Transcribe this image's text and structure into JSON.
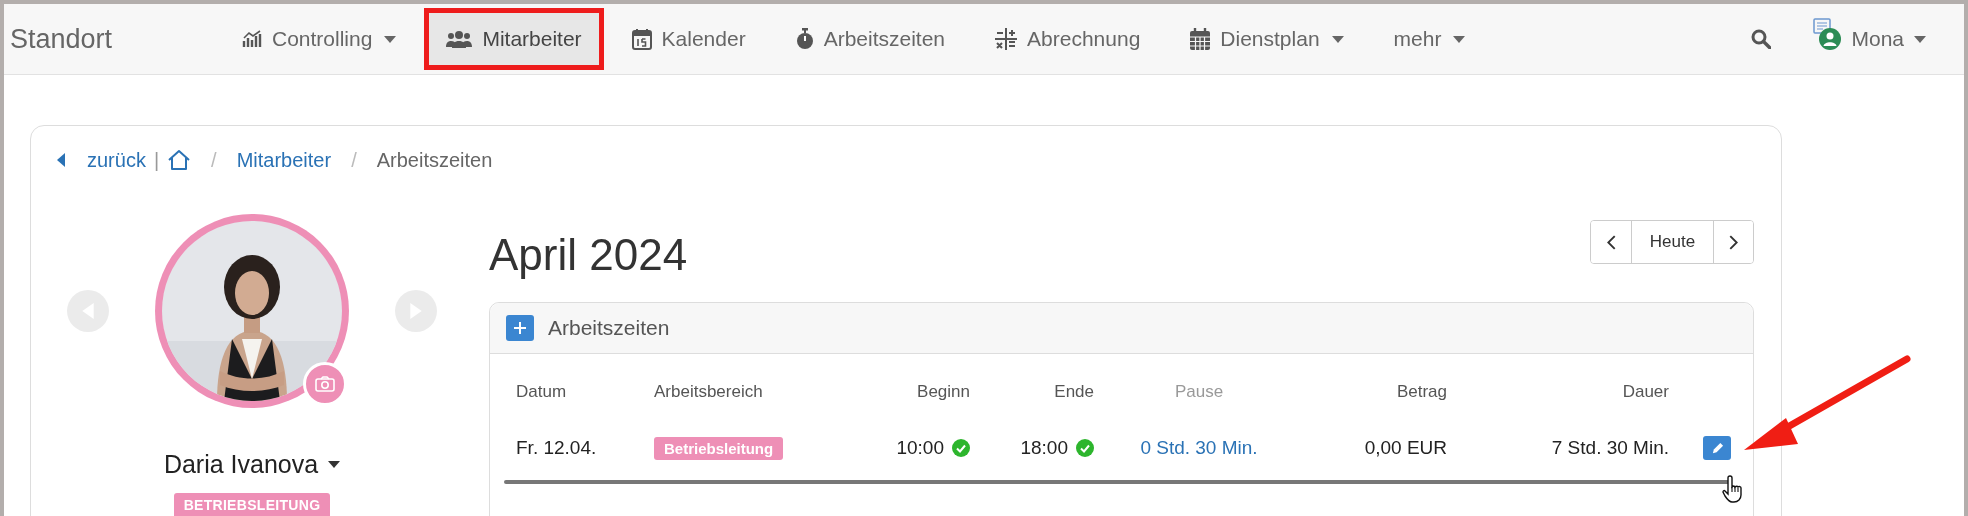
{
  "navbar": {
    "brand": "Standort",
    "items": [
      {
        "label": "Controlling",
        "caret": true,
        "selected": false,
        "outlined": false
      },
      {
        "label": "Mitarbeiter",
        "caret": false,
        "selected": true,
        "outlined": true
      },
      {
        "label": "Kalender",
        "caret": false,
        "selected": false,
        "outlined": false
      },
      {
        "label": "Arbeitszeiten",
        "caret": false,
        "selected": false,
        "outlined": false
      },
      {
        "label": "Abrechnung",
        "caret": false,
        "selected": false,
        "outlined": false
      },
      {
        "label": "Dienstplan",
        "caret": true,
        "selected": false,
        "outlined": false
      },
      {
        "label": "mehr",
        "caret": true,
        "selected": false,
        "outlined": false
      }
    ],
    "user": "Mona"
  },
  "breadcrumb": {
    "back": "zurück",
    "separator": "|",
    "items": [
      {
        "divider": "/",
        "label": "Mitarbeiter",
        "link": true
      },
      {
        "divider": "/",
        "label": "Arbeitszeiten",
        "link": false
      }
    ]
  },
  "profile": {
    "name": "Daria Ivanova",
    "role": "BETRIEBSLEITUNG"
  },
  "month": {
    "title": "April 2024",
    "today": "Heute"
  },
  "panel": {
    "title": "Arbeitszeiten",
    "columns": [
      {
        "label": "Datum",
        "dimmed": false
      },
      {
        "label": "Arbeitsbereich",
        "dimmed": false
      },
      {
        "label": "Beginn",
        "dimmed": false
      },
      {
        "label": "Ende",
        "dimmed": false
      },
      {
        "label": "Pause",
        "dimmed": true
      },
      {
        "label": "Betrag",
        "dimmed": false
      },
      {
        "label": "Dauer",
        "dimmed": false
      }
    ],
    "rows": [
      {
        "date": "Fr. 12.04.",
        "area": "Betriebsleitung",
        "start": "10:00",
        "start_confirmed": true,
        "end": "18:00",
        "end_confirmed": true,
        "pause": "0 Std. 30 Min.",
        "amount": "0,00 EUR",
        "duration": "7 Std. 30 Min."
      }
    ]
  },
  "annotation": {
    "arrow": true
  }
}
